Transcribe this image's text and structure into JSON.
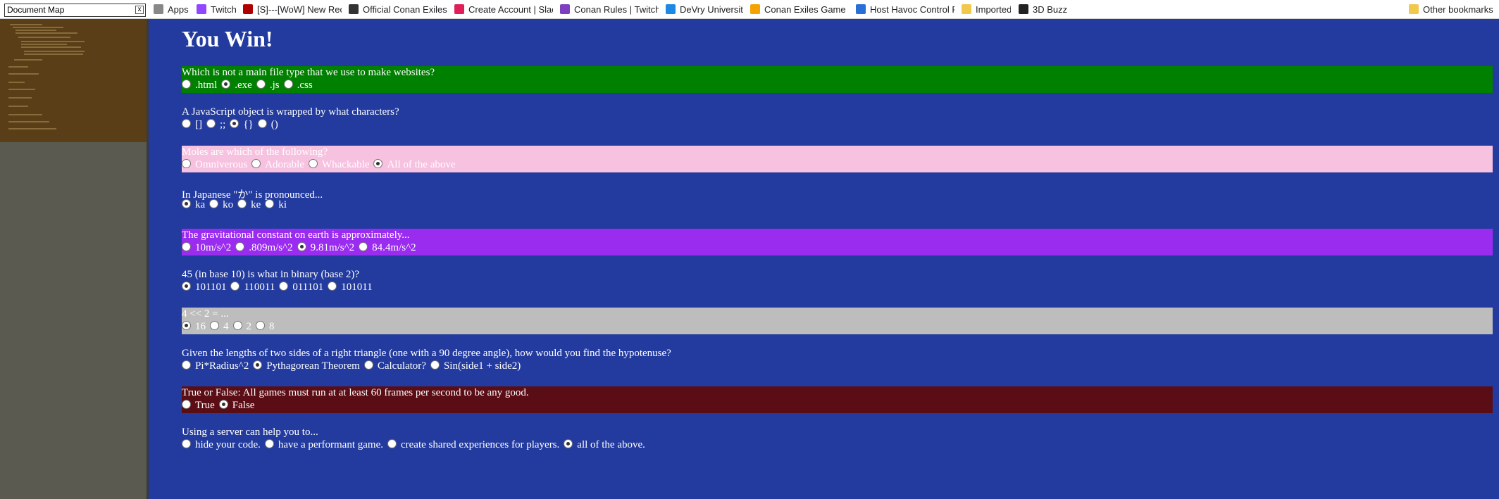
{
  "docmap": {
    "label": "Document Map",
    "close": "x"
  },
  "bookmarks": [
    {
      "label": "Apps",
      "color": "#888888"
    },
    {
      "label": "Twitch",
      "color": "#9146ff"
    },
    {
      "label": "[S]---[WoW] New Rec",
      "color": "#b00000"
    },
    {
      "label": "Official Conan Exiles V",
      "color": "#333333"
    },
    {
      "label": "Create Account | Slac",
      "color": "#e01e5a"
    },
    {
      "label": "Conan Rules | TwitchR",
      "color": "#7d3fbf"
    },
    {
      "label": "DeVry University",
      "color": "#1e88e5"
    },
    {
      "label": "Conan Exiles Game K",
      "color": "#f4a300"
    },
    {
      "label": "Host Havoc Control P",
      "color": "#2a6fd6"
    },
    {
      "label": "Imported",
      "color": "#f2c84b"
    },
    {
      "label": "3D Buzz",
      "color": "#222222"
    }
  ],
  "other_bookmarks": {
    "label": "Other bookmarks",
    "color": "#f2c84b"
  },
  "page": {
    "title": "You Win!"
  },
  "questions": [
    {
      "text": "Which is not a main file type that we use to make websites?",
      "bg": "#008000",
      "options": [
        ".html",
        ".exe",
        ".js",
        ".css"
      ],
      "selected": 1
    },
    {
      "text": "A JavaScript object is wrapped by what characters?",
      "bg": "",
      "options": [
        "[]",
        ";;",
        "{}",
        "()"
      ],
      "selected": 2
    },
    {
      "text": "Moles are which of the following?",
      "bg": "#f7c1e0",
      "options": [
        "Omniverous",
        "Adorable",
        "Whackable",
        "All of the above"
      ],
      "selected": 3
    },
    {
      "text": "In Japanese \"か\" is pronounced...",
      "bg": "",
      "options": [
        "ka",
        "ko",
        "ke",
        "ki"
      ],
      "selected": 0
    },
    {
      "text": "The gravitational constant on earth is approximately...",
      "bg": "#9a2cf0",
      "options": [
        "10m/s^2",
        ".809m/s^2",
        "9.81m/s^2",
        "84.4m/s^2"
      ],
      "selected": 2
    },
    {
      "text": "45 (in base 10) is what in binary (base 2)?",
      "bg": "",
      "options": [
        "101101",
        "110011",
        "011101",
        "101011"
      ],
      "selected": 0
    },
    {
      "text": "4 << 2 = ...",
      "bg": "#bdbdbd",
      "options": [
        "16",
        "4",
        "2",
        "8"
      ],
      "selected": 0
    },
    {
      "text": "Given the lengths of two sides of a right triangle (one with a 90 degree angle), how would you find the hypotenuse?",
      "bg": "",
      "options": [
        "Pi*Radius^2",
        "Pythagorean Theorem",
        "Calculator?",
        "Sin(side1 + side2)"
      ],
      "selected": 1
    },
    {
      "text": "True or False: All games must run at at least 60 frames per second to be any good.",
      "bg": "#5a0d14",
      "options": [
        "True",
        "False"
      ],
      "selected": 1
    },
    {
      "text": "Using a server can help you to...",
      "bg": "",
      "options": [
        "hide your code.",
        "have a performant game.",
        "create shared experiences for players.",
        "all of the above."
      ],
      "selected": 3
    }
  ]
}
